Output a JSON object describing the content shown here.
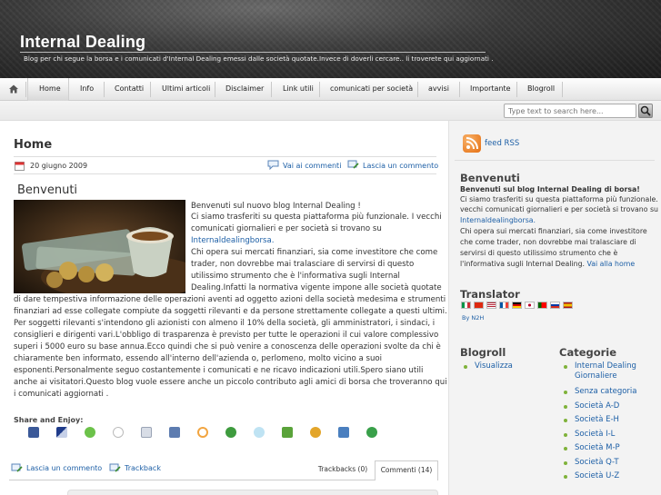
{
  "header": {
    "title": "Internal Dealing",
    "description": "Blog per chi segue la borsa e i comunicati d'Internal Dealing emessi dalle società quotate.Invece di doverli cercare.. li troverete qui aggiornati ."
  },
  "nav": {
    "items": [
      "Home",
      "Info",
      "Contatti",
      "Ultimi articoli",
      "Disclaimer",
      "Link utili",
      "comunicati per società",
      "avvisi",
      "Importante",
      "Blogroll"
    ]
  },
  "search": {
    "placeholder": "Type text to search here..."
  },
  "page": {
    "title": "Home",
    "date": "20 giugno 2009",
    "go_comments": "Vai ai commenti",
    "leave_comment": "Lascia un commento"
  },
  "post": {
    "title": "Benvenuti",
    "lines_right": [
      "Benvenuti sul  nuovo blog Internal Dealing !",
      "Ci siamo trasferiti su questa piattaforma più funzionale. I vecchi",
      "comunicati giornalieri e per società si trovano  su",
      "Internaldealingborsa.",
      "Chi opera sui mercati finanziari, sia come investitore che come",
      "trader, non dovrebbe mai tralasciare di servirsi di questo",
      "utilissimo strumento che è l'informativa sugli Internal",
      "Dealing.Infatti la normativa vigente impone alle società quotate"
    ],
    "link_word": "Internaldealingborsa.",
    "lines_full": [
      "di dare tempestiva informazione delle operazioni aventi ad oggetto azioni della società medesima e strumenti",
      "finanziari ad esse collegate compiute da soggetti rilevanti e da persone strettamente collegate a questi ultimi.",
      "Per soggetti rilevanti s'intendono gli azionisti con almeno il 10% della società, gli amministratori, i sindaci, i",
      "consiglieri e dirigenti vari.L'obbligo di trasparenza è previsto per tutte le operazioni il cui valore complessivo",
      "superi i 5000 euro su base annua.Ecco quindi che si può venire a conoscenza delle operazioni svolte da chi è",
      "chiaramente ben informato, essendo all'interno dell'azienda o, perlomeno, molto vicino a suoi",
      "esponenti.Personalmente seguo costantemente i comunicati e ne ricavo indicazioni utili.Spero siano utili",
      "anche ai visitatori.Questo blog vuole essere anche un piccolo contributo agli amici di borsa che troveranno qui",
      "i comunicati aggiornati ."
    ],
    "share_title": "Share and Enjoy:"
  },
  "footer_bar": {
    "leave_comment": "Lascia un commento",
    "trackback": "Trackback",
    "tab_trackbacks": "Trackbacks (0)",
    "tab_comments": "Commenti (14)"
  },
  "sidebar": {
    "rss": "feed RSS",
    "welcome_title": "Benvenuti",
    "welcome_lines": [
      "Benvenuti sul blog Internal Dealing di borsa!",
      "Ci siamo trasferiti su questa piattaforma più funzionale. I",
      "vecchi comunicati giornalieri e per società si trovano su",
      "Internaldealingborsa.",
      "Chi opera sui mercati finanziari, sia come investitore",
      "che come trader, non dovrebbe mai tralasciare di",
      "servirsi di questo utilissimo strumento che è",
      "l'informativa sugli Internal Dealing."
    ],
    "welcome_link": "Internaldealingborsa.",
    "go_home": "Vai alla home",
    "translator_title": "Translator",
    "translator_by": "By N2H",
    "blogroll_title": "Blogroll",
    "blogroll_items": [
      "Visualizza"
    ],
    "categories_title": "Categorie",
    "categories": [
      "Internal Dealing Giornaliere",
      "Senza categoria",
      "Società A-D",
      "Società E-H",
      "Società I-L",
      "Società M-P",
      "Società Q-T",
      "Società U-Z"
    ]
  },
  "colors": {
    "link": "#1d5fa6",
    "rss": "#e56f12",
    "bullet": "#7fb23a"
  }
}
